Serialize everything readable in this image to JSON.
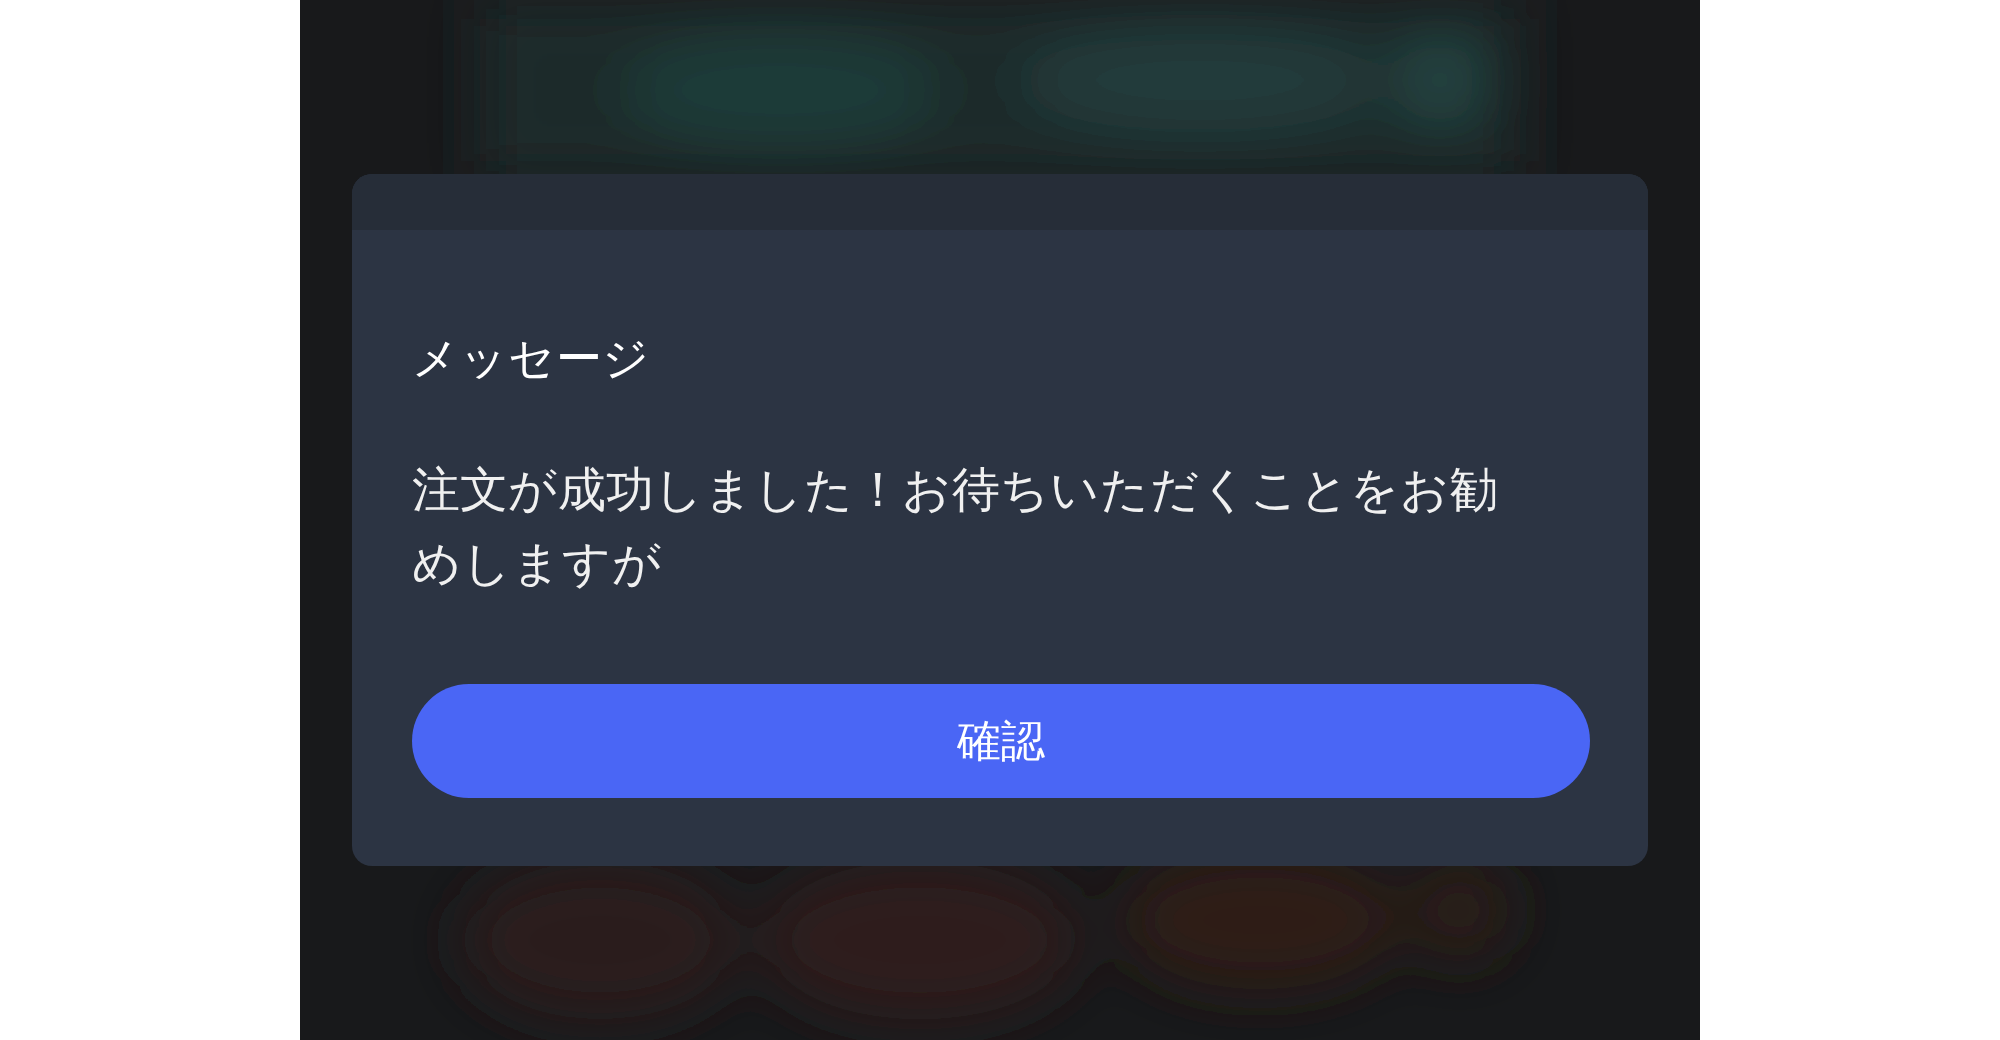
{
  "dialog": {
    "title": "メッセージ",
    "message": "注文が成功しました！お待ちいただくことをお勧めしますが",
    "button": "確認"
  }
}
